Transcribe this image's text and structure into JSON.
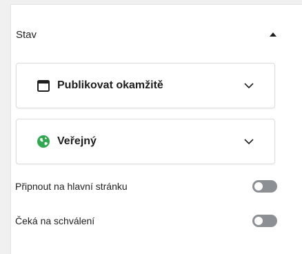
{
  "status_panel": {
    "title": "Stav",
    "collapse_icon": "caret-up-icon"
  },
  "publish_select": {
    "label": "Publikovat okamžitě",
    "icon": "calendar-icon",
    "chevron_icon": "chevron-down-icon"
  },
  "visibility_select": {
    "label": "Veřejný",
    "icon": "globe-icon",
    "icon_color": "#2fa84f",
    "chevron_icon": "chevron-down-icon"
  },
  "toggles": [
    {
      "label": "Připnout na hlavní stránku",
      "checked": false
    },
    {
      "label": "Čeká na schválení",
      "checked": false
    }
  ],
  "colors": {
    "toggle_off": "#8c8f94",
    "border": "#dcdcde"
  }
}
